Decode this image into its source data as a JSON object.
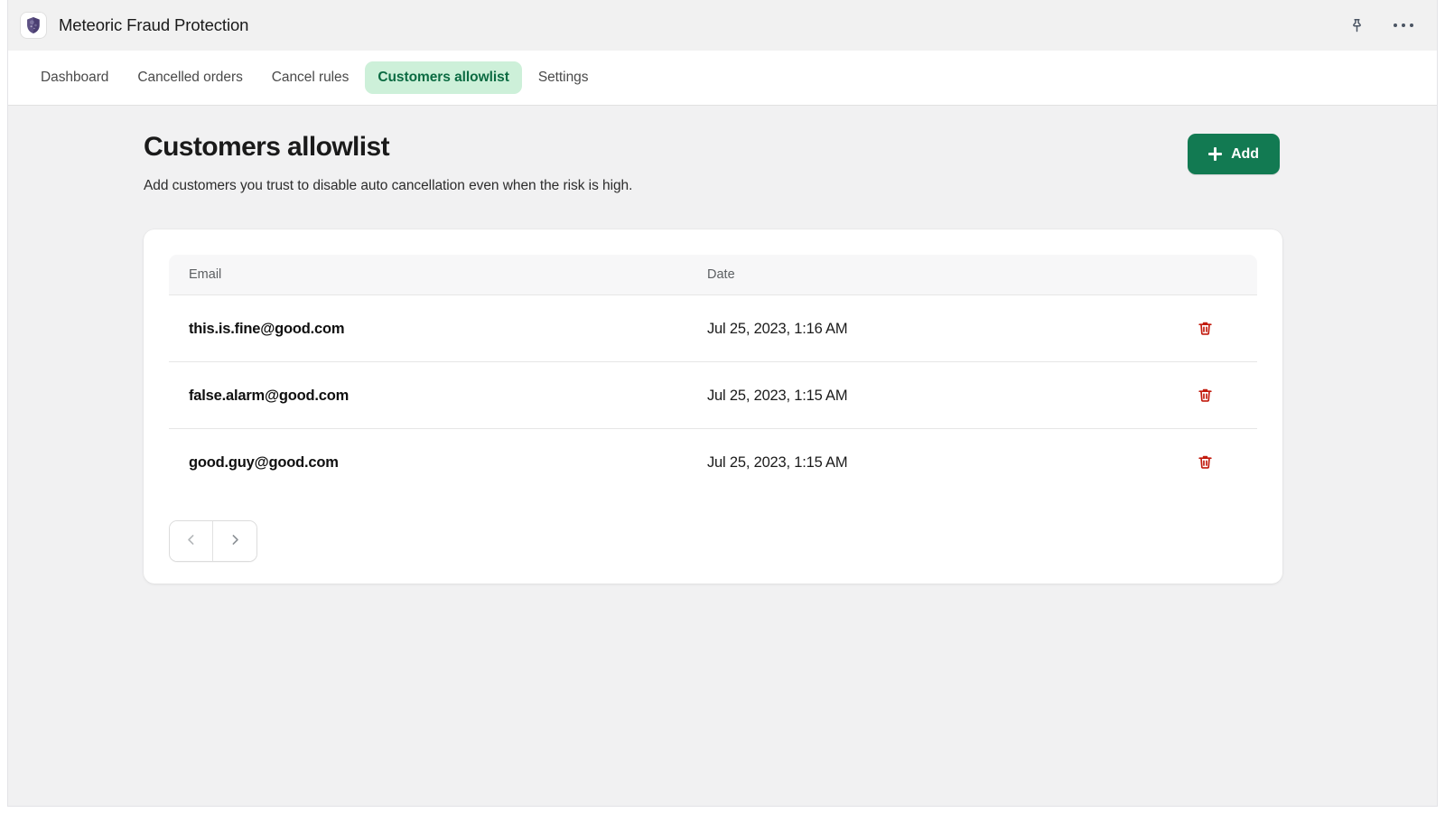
{
  "topbar": {
    "app_title": "Meteoric Fraud Protection",
    "app_icon": "shield-meteor-icon",
    "pin_icon": "pin-icon",
    "more_icon": "more-horizontal-icon"
  },
  "tabs": [
    {
      "label": "Dashboard",
      "active": false
    },
    {
      "label": "Cancelled orders",
      "active": false
    },
    {
      "label": "Cancel rules",
      "active": false
    },
    {
      "label": "Customers allowlist",
      "active": true
    },
    {
      "label": "Settings",
      "active": false
    }
  ],
  "page": {
    "title": "Customers allowlist",
    "subtitle": "Add customers you trust to disable auto cancellation even when the risk is high.",
    "add_label": "Add",
    "add_icon": "plus-icon",
    "accent_green": "#127a52",
    "active_tab_bg": "#cdf0d9",
    "active_tab_text": "#0b6b42",
    "delete_icon_color": "#c21b0e"
  },
  "table": {
    "columns": [
      "Email",
      "Date",
      ""
    ],
    "rows": [
      {
        "email": "this.is.fine@good.com",
        "date": "Jul 25, 2023, 1:16 AM",
        "delete_icon": "trash-icon"
      },
      {
        "email": "false.alarm@good.com",
        "date": "Jul 25, 2023, 1:15 AM",
        "delete_icon": "trash-icon"
      },
      {
        "email": "good.guy@good.com",
        "date": "Jul 25, 2023, 1:15 AM",
        "delete_icon": "trash-icon"
      }
    ]
  },
  "pagination": {
    "prev_icon": "chevron-left-icon",
    "next_icon": "chevron-right-icon"
  }
}
